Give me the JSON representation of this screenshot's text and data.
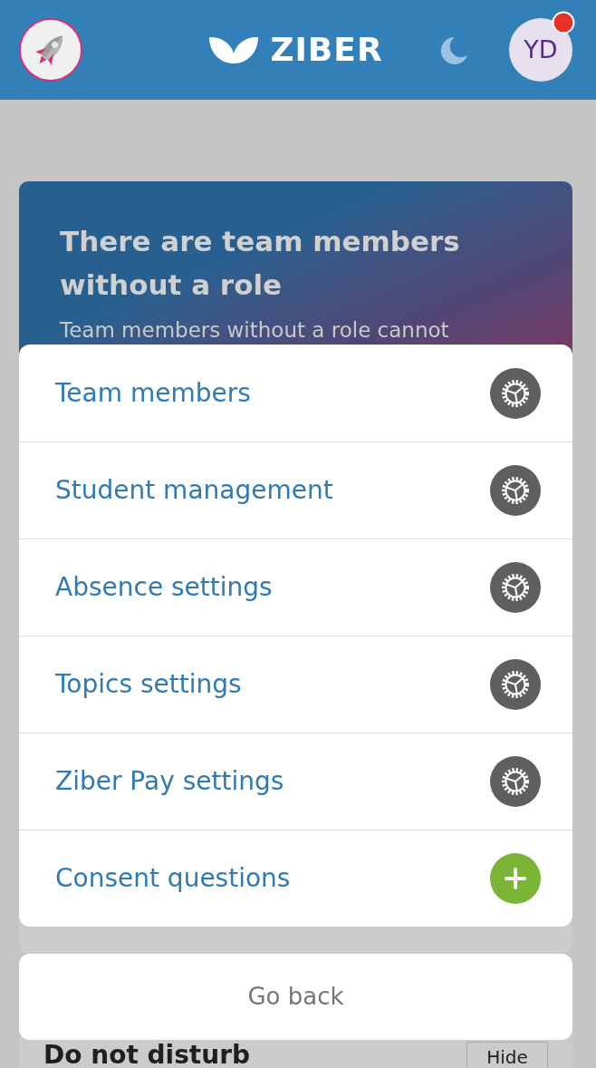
{
  "header": {
    "notification": true,
    "logo_text": "ZIBER",
    "avatar_initials": "YD"
  },
  "banner": {
    "title": "There are team members without a role",
    "text": "Team members without a role cannot"
  },
  "action_sheet": {
    "items": [
      {
        "label": "Team members",
        "kind": "settings"
      },
      {
        "label": "Student management",
        "kind": "settings"
      },
      {
        "label": "Absence settings",
        "kind": "settings"
      },
      {
        "label": "Topics settings",
        "kind": "settings"
      },
      {
        "label": "Ziber Pay settings",
        "kind": "settings"
      },
      {
        "label": "Consent questions",
        "kind": "add"
      }
    ],
    "cancel": "Go back"
  },
  "section": {
    "title": "Do not disturb",
    "button": "Hide"
  }
}
